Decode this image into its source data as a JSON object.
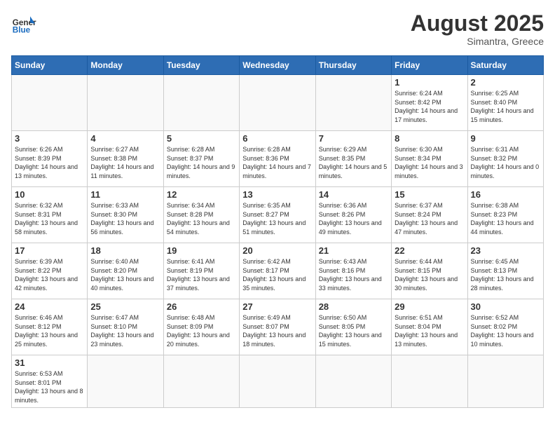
{
  "logo": {
    "text_general": "General",
    "text_blue": "Blue"
  },
  "title": {
    "month_year": "August 2025",
    "location": "Simantra, Greece"
  },
  "weekdays": [
    "Sunday",
    "Monday",
    "Tuesday",
    "Wednesday",
    "Thursday",
    "Friday",
    "Saturday"
  ],
  "weeks": [
    [
      {
        "day": "",
        "info": ""
      },
      {
        "day": "",
        "info": ""
      },
      {
        "day": "",
        "info": ""
      },
      {
        "day": "",
        "info": ""
      },
      {
        "day": "",
        "info": ""
      },
      {
        "day": "1",
        "info": "Sunrise: 6:24 AM\nSunset: 8:42 PM\nDaylight: 14 hours and 17 minutes."
      },
      {
        "day": "2",
        "info": "Sunrise: 6:25 AM\nSunset: 8:40 PM\nDaylight: 14 hours and 15 minutes."
      }
    ],
    [
      {
        "day": "3",
        "info": "Sunrise: 6:26 AM\nSunset: 8:39 PM\nDaylight: 14 hours and 13 minutes."
      },
      {
        "day": "4",
        "info": "Sunrise: 6:27 AM\nSunset: 8:38 PM\nDaylight: 14 hours and 11 minutes."
      },
      {
        "day": "5",
        "info": "Sunrise: 6:28 AM\nSunset: 8:37 PM\nDaylight: 14 hours and 9 minutes."
      },
      {
        "day": "6",
        "info": "Sunrise: 6:28 AM\nSunset: 8:36 PM\nDaylight: 14 hours and 7 minutes."
      },
      {
        "day": "7",
        "info": "Sunrise: 6:29 AM\nSunset: 8:35 PM\nDaylight: 14 hours and 5 minutes."
      },
      {
        "day": "8",
        "info": "Sunrise: 6:30 AM\nSunset: 8:34 PM\nDaylight: 14 hours and 3 minutes."
      },
      {
        "day": "9",
        "info": "Sunrise: 6:31 AM\nSunset: 8:32 PM\nDaylight: 14 hours and 0 minutes."
      }
    ],
    [
      {
        "day": "10",
        "info": "Sunrise: 6:32 AM\nSunset: 8:31 PM\nDaylight: 13 hours and 58 minutes."
      },
      {
        "day": "11",
        "info": "Sunrise: 6:33 AM\nSunset: 8:30 PM\nDaylight: 13 hours and 56 minutes."
      },
      {
        "day": "12",
        "info": "Sunrise: 6:34 AM\nSunset: 8:28 PM\nDaylight: 13 hours and 54 minutes."
      },
      {
        "day": "13",
        "info": "Sunrise: 6:35 AM\nSunset: 8:27 PM\nDaylight: 13 hours and 51 minutes."
      },
      {
        "day": "14",
        "info": "Sunrise: 6:36 AM\nSunset: 8:26 PM\nDaylight: 13 hours and 49 minutes."
      },
      {
        "day": "15",
        "info": "Sunrise: 6:37 AM\nSunset: 8:24 PM\nDaylight: 13 hours and 47 minutes."
      },
      {
        "day": "16",
        "info": "Sunrise: 6:38 AM\nSunset: 8:23 PM\nDaylight: 13 hours and 44 minutes."
      }
    ],
    [
      {
        "day": "17",
        "info": "Sunrise: 6:39 AM\nSunset: 8:22 PM\nDaylight: 13 hours and 42 minutes."
      },
      {
        "day": "18",
        "info": "Sunrise: 6:40 AM\nSunset: 8:20 PM\nDaylight: 13 hours and 40 minutes."
      },
      {
        "day": "19",
        "info": "Sunrise: 6:41 AM\nSunset: 8:19 PM\nDaylight: 13 hours and 37 minutes."
      },
      {
        "day": "20",
        "info": "Sunrise: 6:42 AM\nSunset: 8:17 PM\nDaylight: 13 hours and 35 minutes."
      },
      {
        "day": "21",
        "info": "Sunrise: 6:43 AM\nSunset: 8:16 PM\nDaylight: 13 hours and 33 minutes."
      },
      {
        "day": "22",
        "info": "Sunrise: 6:44 AM\nSunset: 8:15 PM\nDaylight: 13 hours and 30 minutes."
      },
      {
        "day": "23",
        "info": "Sunrise: 6:45 AM\nSunset: 8:13 PM\nDaylight: 13 hours and 28 minutes."
      }
    ],
    [
      {
        "day": "24",
        "info": "Sunrise: 6:46 AM\nSunset: 8:12 PM\nDaylight: 13 hours and 25 minutes."
      },
      {
        "day": "25",
        "info": "Sunrise: 6:47 AM\nSunset: 8:10 PM\nDaylight: 13 hours and 23 minutes."
      },
      {
        "day": "26",
        "info": "Sunrise: 6:48 AM\nSunset: 8:09 PM\nDaylight: 13 hours and 20 minutes."
      },
      {
        "day": "27",
        "info": "Sunrise: 6:49 AM\nSunset: 8:07 PM\nDaylight: 13 hours and 18 minutes."
      },
      {
        "day": "28",
        "info": "Sunrise: 6:50 AM\nSunset: 8:05 PM\nDaylight: 13 hours and 15 minutes."
      },
      {
        "day": "29",
        "info": "Sunrise: 6:51 AM\nSunset: 8:04 PM\nDaylight: 13 hours and 13 minutes."
      },
      {
        "day": "30",
        "info": "Sunrise: 6:52 AM\nSunset: 8:02 PM\nDaylight: 13 hours and 10 minutes."
      }
    ],
    [
      {
        "day": "31",
        "info": "Sunrise: 6:53 AM\nSunset: 8:01 PM\nDaylight: 13 hours and 8 minutes."
      },
      {
        "day": "",
        "info": ""
      },
      {
        "day": "",
        "info": ""
      },
      {
        "day": "",
        "info": ""
      },
      {
        "day": "",
        "info": ""
      },
      {
        "day": "",
        "info": ""
      },
      {
        "day": "",
        "info": ""
      }
    ]
  ]
}
